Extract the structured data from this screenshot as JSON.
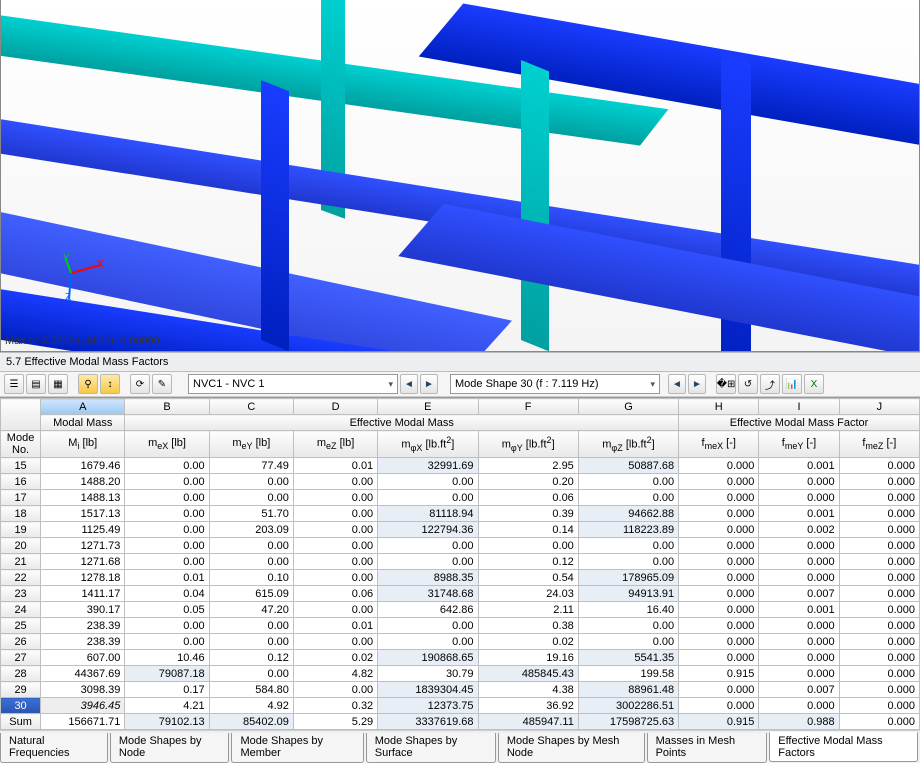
{
  "viewport": {
    "status": "Max u: 3.28084, Min u: 0.00000 -",
    "axes": {
      "x": "X",
      "y": "Y",
      "z": "Z"
    }
  },
  "panel_title": "5.7 Effective Modal Mass Factors",
  "toolbar": {
    "combo1": "NVC1 - NVC 1",
    "combo2": "Mode Shape 30 (f : 7.119 Hz)"
  },
  "columns": {
    "letters": [
      "A",
      "B",
      "C",
      "D",
      "E",
      "F",
      "G",
      "H",
      "I",
      "J"
    ],
    "mode": "Mode",
    "no": "No.",
    "modal_mass": "Modal Mass",
    "eff_mass": "Effective Modal Mass",
    "eff_factor": "Effective Modal Mass Factor",
    "Mi": "M<span class='sub'>i</span> [lb]",
    "meX": "m<span class='sub'>eX</span> [lb]",
    "meY": "m<span class='sub'>eY</span> [lb]",
    "meZ": "m<span class='sub'>eZ</span> [lb]",
    "mphiX": "m<span class='sub'>φX</span> [lb.ft<span class='sup'>2</span>]",
    "mphiY": "m<span class='sub'>φY</span> [lb.ft<span class='sup'>2</span>]",
    "mphiZ": "m<span class='sub'>φZ</span> [lb.ft<span class='sup'>2</span>]",
    "fmeX": "f<span class='sub'>meX</span> [-]",
    "fmeY": "f<span class='sub'>meY</span> [-]",
    "fmeZ": "f<span class='sub'>meZ</span> [-]"
  },
  "rows": [
    {
      "no": "15",
      "A": "1679.46",
      "B": "0.00",
      "C": "77.49",
      "D": "0.01",
      "E": "32991.69",
      "F": "2.95",
      "G": "50887.68",
      "H": "0.000",
      "I": "0.001",
      "J": "0.000",
      "sh": [
        "E",
        "G"
      ]
    },
    {
      "no": "16",
      "A": "1488.20",
      "B": "0.00",
      "C": "0.00",
      "D": "0.00",
      "E": "0.00",
      "F": "0.20",
      "G": "0.00",
      "H": "0.000",
      "I": "0.000",
      "J": "0.000",
      "sh": []
    },
    {
      "no": "17",
      "A": "1488.13",
      "B": "0.00",
      "C": "0.00",
      "D": "0.00",
      "E": "0.00",
      "F": "0.06",
      "G": "0.00",
      "H": "0.000",
      "I": "0.000",
      "J": "0.000",
      "sh": []
    },
    {
      "no": "18",
      "A": "1517.13",
      "B": "0.00",
      "C": "51.70",
      "D": "0.00",
      "E": "81118.94",
      "F": "0.39",
      "G": "94662.88",
      "H": "0.000",
      "I": "0.001",
      "J": "0.000",
      "sh": [
        "E",
        "G"
      ]
    },
    {
      "no": "19",
      "A": "1125.49",
      "B": "0.00",
      "C": "203.09",
      "D": "0.00",
      "E": "122794.36",
      "F": "0.14",
      "G": "118223.89",
      "H": "0.000",
      "I": "0.002",
      "J": "0.000",
      "sh": [
        "E",
        "G"
      ]
    },
    {
      "no": "20",
      "A": "1271.73",
      "B": "0.00",
      "C": "0.00",
      "D": "0.00",
      "E": "0.00",
      "F": "0.00",
      "G": "0.00",
      "H": "0.000",
      "I": "0.000",
      "J": "0.000",
      "sh": []
    },
    {
      "no": "21",
      "A": "1271.68",
      "B": "0.00",
      "C": "0.00",
      "D": "0.00",
      "E": "0.00",
      "F": "0.12",
      "G": "0.00",
      "H": "0.000",
      "I": "0.000",
      "J": "0.000",
      "sh": []
    },
    {
      "no": "22",
      "A": "1278.18",
      "B": "0.01",
      "C": "0.10",
      "D": "0.00",
      "E": "8988.35",
      "F": "0.54",
      "G": "178965.09",
      "H": "0.000",
      "I": "0.000",
      "J": "0.000",
      "sh": [
        "E",
        "G"
      ]
    },
    {
      "no": "23",
      "A": "1411.17",
      "B": "0.04",
      "C": "615.09",
      "D": "0.06",
      "E": "31748.68",
      "F": "24.03",
      "G": "94913.91",
      "H": "0.000",
      "I": "0.007",
      "J": "0.000",
      "sh": [
        "E",
        "G"
      ]
    },
    {
      "no": "24",
      "A": "390.17",
      "B": "0.05",
      "C": "47.20",
      "D": "0.00",
      "E": "642.86",
      "F": "2.11",
      "G": "16.40",
      "H": "0.000",
      "I": "0.001",
      "J": "0.000",
      "sh": []
    },
    {
      "no": "25",
      "A": "238.39",
      "B": "0.00",
      "C": "0.00",
      "D": "0.01",
      "E": "0.00",
      "F": "0.38",
      "G": "0.00",
      "H": "0.000",
      "I": "0.000",
      "J": "0.000",
      "sh": []
    },
    {
      "no": "26",
      "A": "238.39",
      "B": "0.00",
      "C": "0.00",
      "D": "0.00",
      "E": "0.00",
      "F": "0.02",
      "G": "0.00",
      "H": "0.000",
      "I": "0.000",
      "J": "0.000",
      "sh": []
    },
    {
      "no": "27",
      "A": "607.00",
      "B": "10.46",
      "C": "0.12",
      "D": "0.02",
      "E": "190868.65",
      "F": "19.16",
      "G": "5541.35",
      "H": "0.000",
      "I": "0.000",
      "J": "0.000",
      "sh": [
        "E",
        "G"
      ]
    },
    {
      "no": "28",
      "A": "44367.69",
      "B": "79087.18",
      "C": "0.00",
      "D": "4.82",
      "E": "30.79",
      "F": "485845.43",
      "G": "199.58",
      "H": "0.915",
      "I": "0.000",
      "J": "0.000",
      "sh": [
        "B",
        "F"
      ]
    },
    {
      "no": "29",
      "A": "3098.39",
      "B": "0.17",
      "C": "584.80",
      "D": "0.00",
      "E": "1839304.45",
      "F": "4.38",
      "G": "88961.48",
      "H": "0.000",
      "I": "0.007",
      "J": "0.000",
      "sh": [
        "E",
        "G"
      ]
    },
    {
      "no": "30",
      "A": "3946.45",
      "B": "4.21",
      "C": "4.92",
      "D": "0.32",
      "E": "12373.75",
      "F": "36.92",
      "G": "3002286.51",
      "H": "0.000",
      "I": "0.000",
      "J": "0.000",
      "sh": [
        "E",
        "G"
      ],
      "sel": true
    },
    {
      "no": "Sum",
      "A": "156671.71",
      "B": "79102.13",
      "C": "85402.09",
      "D": "5.29",
      "E": "3337619.68",
      "F": "485947.11",
      "G": "17598725.63",
      "H": "0.915",
      "I": "0.988",
      "J": "0.000",
      "sh": [
        "B",
        "C",
        "E",
        "F",
        "G",
        "H",
        "I"
      ]
    }
  ],
  "tabs": [
    {
      "label": "Natural Frequencies",
      "active": false
    },
    {
      "label": "Mode Shapes by Node",
      "active": false
    },
    {
      "label": "Mode Shapes by Member",
      "active": false
    },
    {
      "label": "Mode Shapes by Surface",
      "active": false
    },
    {
      "label": "Mode Shapes by Mesh Node",
      "active": false
    },
    {
      "label": "Masses in Mesh Points",
      "active": false
    },
    {
      "label": "Effective Modal Mass Factors",
      "active": true
    }
  ]
}
